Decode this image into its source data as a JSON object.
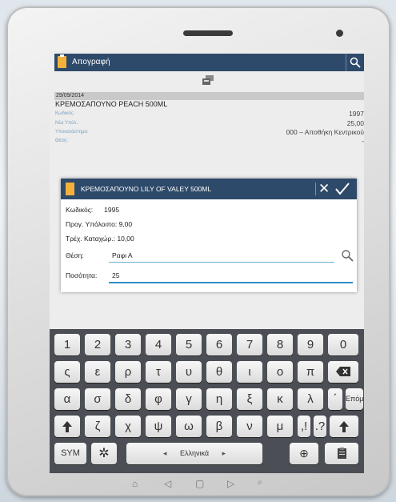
{
  "app": {
    "title": "Απογραφή"
  },
  "record": {
    "date": "29/09/2014",
    "product_title": "ΚΡΕΜΟΣΑΠΟΥΝΟ PEACH 500ML",
    "fields": [
      {
        "label": "Κωδικός:",
        "value": "1997"
      },
      {
        "label": "Νέα Υπόλ.:",
        "value": "25,00"
      },
      {
        "label": "Υποκατάστημα:",
        "value": "000 – Αποθήκη Κεντρικού"
      },
      {
        "label": "Θέση:",
        "value": "-"
      }
    ]
  },
  "dialog": {
    "title": "ΚΡΕΜΟΣΑΠΟΥΝΟ LILY OF VALEY 500ML",
    "code_label": "Κωδικός:",
    "code_value": "1995",
    "prev_label": "Προγ. Υπόλοιπο:",
    "prev_value": "9,00",
    "curr_label": "Τρέχ. Καταχώρ.:",
    "curr_value": "10,00",
    "location_label": "Θέση:",
    "location_value": "Ραφι Α",
    "qty_label": "Ποσότητα:",
    "qty_value": "25"
  },
  "keyboard": {
    "row_numbers": [
      "1",
      "2",
      "3",
      "4",
      "5",
      "6",
      "7",
      "8",
      "9",
      "0"
    ],
    "row1": [
      "ς",
      "ε",
      "ρ",
      "τ",
      "υ",
      "θ",
      "ι",
      "ο",
      "π"
    ],
    "row2": [
      "α",
      "σ",
      "δ",
      "φ",
      "γ",
      "η",
      "ξ",
      "κ",
      "λ",
      "΄"
    ],
    "row3": [
      "ζ",
      "χ",
      "ψ",
      "ω",
      "β",
      "ν",
      "μ",
      ",!",
      ".?"
    ],
    "enter_label": "Επόμ.",
    "sym_label": "SYM",
    "space_label": "Ελληνικά"
  },
  "colors": {
    "action_bar": "#2e4a6a",
    "accent_icon": "#f3b13c",
    "field_line": "#6fb0d2"
  }
}
